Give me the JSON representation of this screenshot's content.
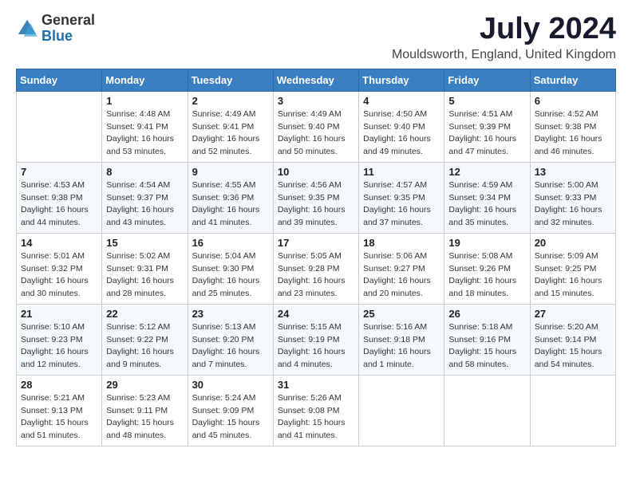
{
  "logo": {
    "text_general": "General",
    "text_blue": "Blue"
  },
  "title": "July 2024",
  "location": "Mouldsworth, England, United Kingdom",
  "days_of_week": [
    "Sunday",
    "Monday",
    "Tuesday",
    "Wednesday",
    "Thursday",
    "Friday",
    "Saturday"
  ],
  "weeks": [
    [
      {
        "day": "",
        "sunrise": "",
        "sunset": "",
        "daylight": ""
      },
      {
        "day": "1",
        "sunrise": "Sunrise: 4:48 AM",
        "sunset": "Sunset: 9:41 PM",
        "daylight": "Daylight: 16 hours and 53 minutes."
      },
      {
        "day": "2",
        "sunrise": "Sunrise: 4:49 AM",
        "sunset": "Sunset: 9:41 PM",
        "daylight": "Daylight: 16 hours and 52 minutes."
      },
      {
        "day": "3",
        "sunrise": "Sunrise: 4:49 AM",
        "sunset": "Sunset: 9:40 PM",
        "daylight": "Daylight: 16 hours and 50 minutes."
      },
      {
        "day": "4",
        "sunrise": "Sunrise: 4:50 AM",
        "sunset": "Sunset: 9:40 PM",
        "daylight": "Daylight: 16 hours and 49 minutes."
      },
      {
        "day": "5",
        "sunrise": "Sunrise: 4:51 AM",
        "sunset": "Sunset: 9:39 PM",
        "daylight": "Daylight: 16 hours and 47 minutes."
      },
      {
        "day": "6",
        "sunrise": "Sunrise: 4:52 AM",
        "sunset": "Sunset: 9:38 PM",
        "daylight": "Daylight: 16 hours and 46 minutes."
      }
    ],
    [
      {
        "day": "7",
        "sunrise": "Sunrise: 4:53 AM",
        "sunset": "Sunset: 9:38 PM",
        "daylight": "Daylight: 16 hours and 44 minutes."
      },
      {
        "day": "8",
        "sunrise": "Sunrise: 4:54 AM",
        "sunset": "Sunset: 9:37 PM",
        "daylight": "Daylight: 16 hours and 43 minutes."
      },
      {
        "day": "9",
        "sunrise": "Sunrise: 4:55 AM",
        "sunset": "Sunset: 9:36 PM",
        "daylight": "Daylight: 16 hours and 41 minutes."
      },
      {
        "day": "10",
        "sunrise": "Sunrise: 4:56 AM",
        "sunset": "Sunset: 9:35 PM",
        "daylight": "Daylight: 16 hours and 39 minutes."
      },
      {
        "day": "11",
        "sunrise": "Sunrise: 4:57 AM",
        "sunset": "Sunset: 9:35 PM",
        "daylight": "Daylight: 16 hours and 37 minutes."
      },
      {
        "day": "12",
        "sunrise": "Sunrise: 4:59 AM",
        "sunset": "Sunset: 9:34 PM",
        "daylight": "Daylight: 16 hours and 35 minutes."
      },
      {
        "day": "13",
        "sunrise": "Sunrise: 5:00 AM",
        "sunset": "Sunset: 9:33 PM",
        "daylight": "Daylight: 16 hours and 32 minutes."
      }
    ],
    [
      {
        "day": "14",
        "sunrise": "Sunrise: 5:01 AM",
        "sunset": "Sunset: 9:32 PM",
        "daylight": "Daylight: 16 hours and 30 minutes."
      },
      {
        "day": "15",
        "sunrise": "Sunrise: 5:02 AM",
        "sunset": "Sunset: 9:31 PM",
        "daylight": "Daylight: 16 hours and 28 minutes."
      },
      {
        "day": "16",
        "sunrise": "Sunrise: 5:04 AM",
        "sunset": "Sunset: 9:30 PM",
        "daylight": "Daylight: 16 hours and 25 minutes."
      },
      {
        "day": "17",
        "sunrise": "Sunrise: 5:05 AM",
        "sunset": "Sunset: 9:28 PM",
        "daylight": "Daylight: 16 hours and 23 minutes."
      },
      {
        "day": "18",
        "sunrise": "Sunrise: 5:06 AM",
        "sunset": "Sunset: 9:27 PM",
        "daylight": "Daylight: 16 hours and 20 minutes."
      },
      {
        "day": "19",
        "sunrise": "Sunrise: 5:08 AM",
        "sunset": "Sunset: 9:26 PM",
        "daylight": "Daylight: 16 hours and 18 minutes."
      },
      {
        "day": "20",
        "sunrise": "Sunrise: 5:09 AM",
        "sunset": "Sunset: 9:25 PM",
        "daylight": "Daylight: 16 hours and 15 minutes."
      }
    ],
    [
      {
        "day": "21",
        "sunrise": "Sunrise: 5:10 AM",
        "sunset": "Sunset: 9:23 PM",
        "daylight": "Daylight: 16 hours and 12 minutes."
      },
      {
        "day": "22",
        "sunrise": "Sunrise: 5:12 AM",
        "sunset": "Sunset: 9:22 PM",
        "daylight": "Daylight: 16 hours and 9 minutes."
      },
      {
        "day": "23",
        "sunrise": "Sunrise: 5:13 AM",
        "sunset": "Sunset: 9:20 PM",
        "daylight": "Daylight: 16 hours and 7 minutes."
      },
      {
        "day": "24",
        "sunrise": "Sunrise: 5:15 AM",
        "sunset": "Sunset: 9:19 PM",
        "daylight": "Daylight: 16 hours and 4 minutes."
      },
      {
        "day": "25",
        "sunrise": "Sunrise: 5:16 AM",
        "sunset": "Sunset: 9:18 PM",
        "daylight": "Daylight: 16 hours and 1 minute."
      },
      {
        "day": "26",
        "sunrise": "Sunrise: 5:18 AM",
        "sunset": "Sunset: 9:16 PM",
        "daylight": "Daylight: 15 hours and 58 minutes."
      },
      {
        "day": "27",
        "sunrise": "Sunrise: 5:20 AM",
        "sunset": "Sunset: 9:14 PM",
        "daylight": "Daylight: 15 hours and 54 minutes."
      }
    ],
    [
      {
        "day": "28",
        "sunrise": "Sunrise: 5:21 AM",
        "sunset": "Sunset: 9:13 PM",
        "daylight": "Daylight: 15 hours and 51 minutes."
      },
      {
        "day": "29",
        "sunrise": "Sunrise: 5:23 AM",
        "sunset": "Sunset: 9:11 PM",
        "daylight": "Daylight: 15 hours and 48 minutes."
      },
      {
        "day": "30",
        "sunrise": "Sunrise: 5:24 AM",
        "sunset": "Sunset: 9:09 PM",
        "daylight": "Daylight: 15 hours and 45 minutes."
      },
      {
        "day": "31",
        "sunrise": "Sunrise: 5:26 AM",
        "sunset": "Sunset: 9:08 PM",
        "daylight": "Daylight: 15 hours and 41 minutes."
      },
      {
        "day": "",
        "sunrise": "",
        "sunset": "",
        "daylight": ""
      },
      {
        "day": "",
        "sunrise": "",
        "sunset": "",
        "daylight": ""
      },
      {
        "day": "",
        "sunrise": "",
        "sunset": "",
        "daylight": ""
      }
    ]
  ]
}
